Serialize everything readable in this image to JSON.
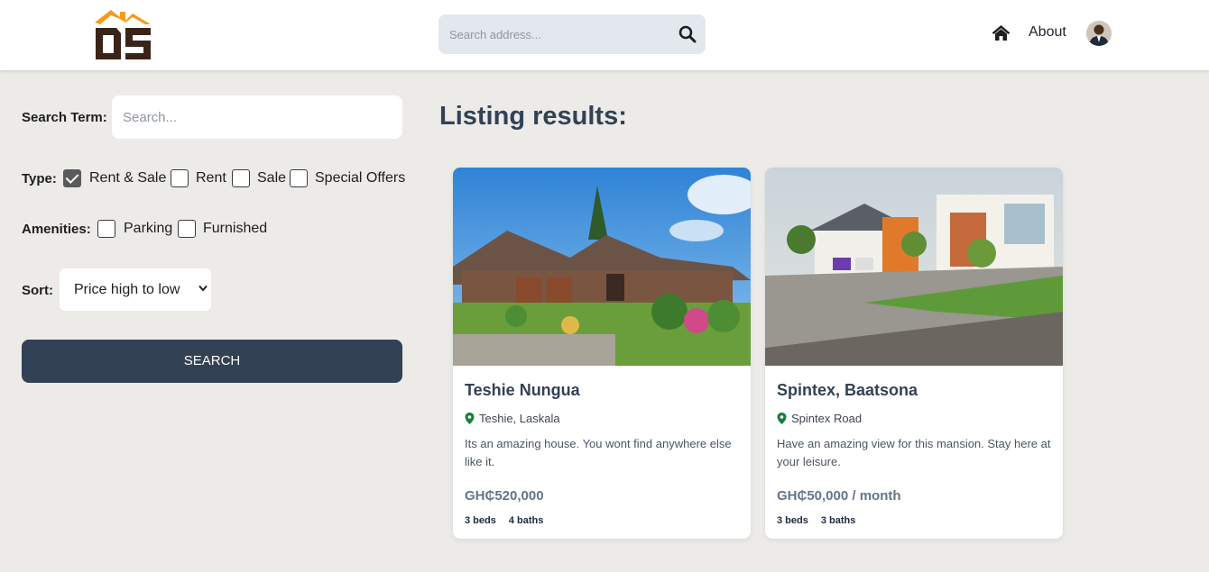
{
  "header": {
    "logo_text": "OS",
    "search_placeholder": "Search address...",
    "nav": {
      "about_label": "About"
    }
  },
  "sidebar": {
    "search_term_label": "Search Term:",
    "search_term_placeholder": "Search...",
    "type_label": "Type:",
    "type_options": [
      {
        "label": "Rent & Sale",
        "checked": true
      },
      {
        "label": "Rent",
        "checked": false
      },
      {
        "label": "Sale",
        "checked": false
      },
      {
        "label": "Special Offers",
        "checked": false
      }
    ],
    "amenities_label": "Amenities:",
    "amenity_options": [
      {
        "label": "Parking",
        "checked": false
      },
      {
        "label": "Furnished",
        "checked": false
      }
    ],
    "sort_label": "Sort:",
    "sort_value": "Price high to low",
    "search_button": "Search"
  },
  "main": {
    "title": "Listing results:",
    "listings": [
      {
        "title": "Teshie Nungua",
        "location": "Teshie, Laskala",
        "description": "Its an amazing house. You wont find anywhere else like it.",
        "price": "GH₵520,000",
        "beds": "3 beds",
        "baths": "4 baths"
      },
      {
        "title": "Spintex, Baatsona",
        "location": "Spintex Road",
        "description": "Have an amazing view for this mansion. Stay here at your leisure.",
        "price": "GH₵50,000 / month",
        "beds": "3 beds",
        "baths": "3 baths"
      }
    ]
  },
  "colors": {
    "logo_orange": "#f49a1e",
    "logo_brown": "#3a2418",
    "button_dark": "#334155",
    "pin_green": "#15803d"
  }
}
